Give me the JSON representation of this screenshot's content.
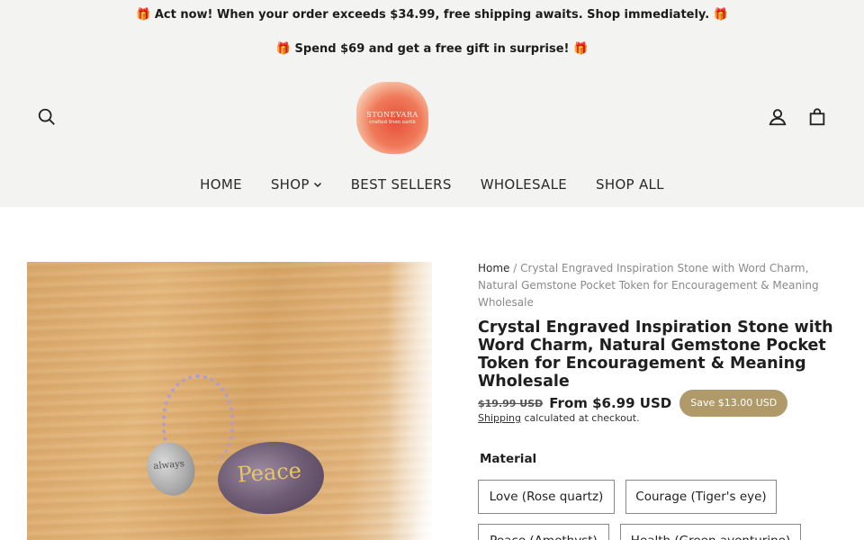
{
  "announcements": [
    "🎁 Act now! When your order exceeds $34.99, free shipping awaits. Shop immediately. 🎁",
    "🎁 Spend $69 and get a free gift in surprise! 🎁"
  ],
  "header": {
    "logo": {
      "name": "STONEVARA",
      "tagline": "crafted from earth"
    },
    "icons": {
      "search": "search-icon",
      "account": "user-icon",
      "cart": "shopping-bag-icon"
    }
  },
  "nav": {
    "items": [
      {
        "label": "HOME"
      },
      {
        "label": "SHOP"
      },
      {
        "label": "BEST SELLERS"
      },
      {
        "label": "WHOLESALE"
      },
      {
        "label": "SHOP ALL"
      }
    ]
  },
  "product_image": {
    "stone_word": "Peace",
    "charm_word": "always"
  },
  "breadcrumb": {
    "home": "Home",
    "separator": "/",
    "current": "Crystal Engraved Inspiration Stone with Word Charm, Natural Gemstone Pocket Token for Encouragement & Meaning Wholesale"
  },
  "product": {
    "title": "Crystal Engraved Inspiration Stone with Word Charm, Natural Gemstone Pocket Token for Encouragement & Meaning Wholesale",
    "compare_price": "$19.99 USD",
    "price": "From $6.99 USD",
    "save_badge": "Save $13.00 USD",
    "shipping_link": "Shipping",
    "tax_text": " calculated at checkout.",
    "option_label": "Material",
    "variants": [
      "Love (Rose quartz)",
      "Courage (Tiger's eye)",
      "Peace (Amethyst)",
      "Health (Green aventurine)"
    ]
  },
  "colors": {
    "header_bg": "#f3f3f1",
    "badge_bg": "#b09a6a",
    "text": "#1f1f1f"
  }
}
